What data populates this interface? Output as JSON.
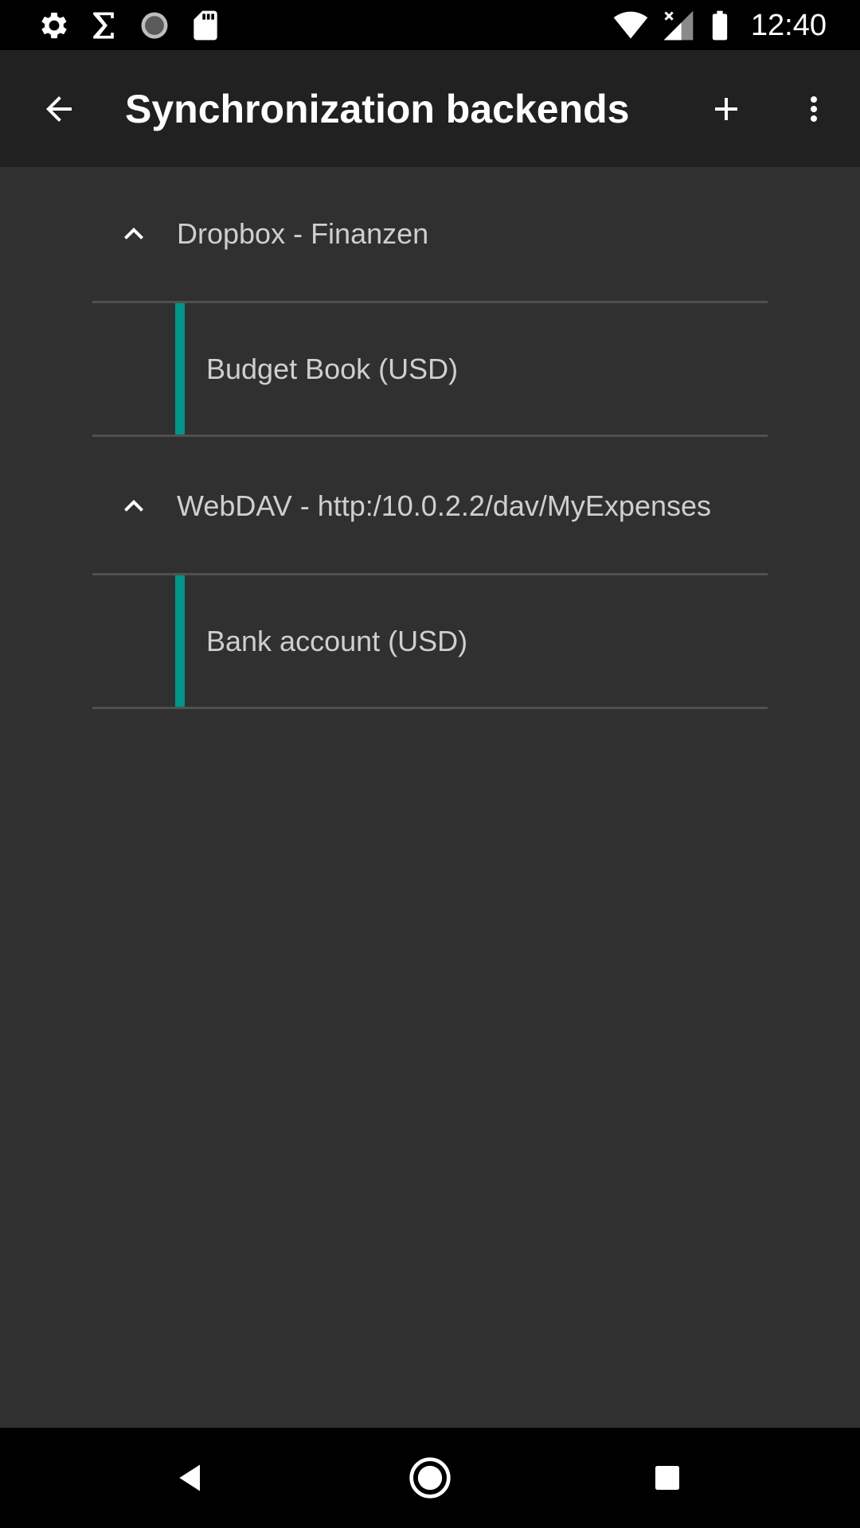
{
  "status_bar": {
    "time": "12:40",
    "icons": [
      "settings-icon",
      "sigma-icon",
      "sync-progress-icon",
      "sd-card-icon",
      "wifi-icon",
      "signal-icon",
      "battery-icon"
    ]
  },
  "app_bar": {
    "title": "Synchronization backends",
    "icons": [
      "back-arrow-icon",
      "add-icon",
      "more-vert-icon"
    ]
  },
  "groups": [
    {
      "title": "Dropbox - Finanzen",
      "expanded": true,
      "children": [
        {
          "label": "Budget Book (USD)",
          "accent_color": "#009688"
        }
      ]
    },
    {
      "title": "WebDAV - http:/10.0.2.2/dav/MyExpenses",
      "expanded": true,
      "children": [
        {
          "label": "Bank account (USD)",
          "accent_color": "#009688"
        }
      ]
    }
  ],
  "nav_bar": {
    "icons": [
      "nav-back-icon",
      "nav-home-icon",
      "nav-recents-icon"
    ]
  },
  "colors": {
    "background": "#303030",
    "app_bar": "#212121",
    "accent": "#009688",
    "text_primary": "#ffffff",
    "text_secondary": "#cfcfcf",
    "divider": "#505050"
  }
}
